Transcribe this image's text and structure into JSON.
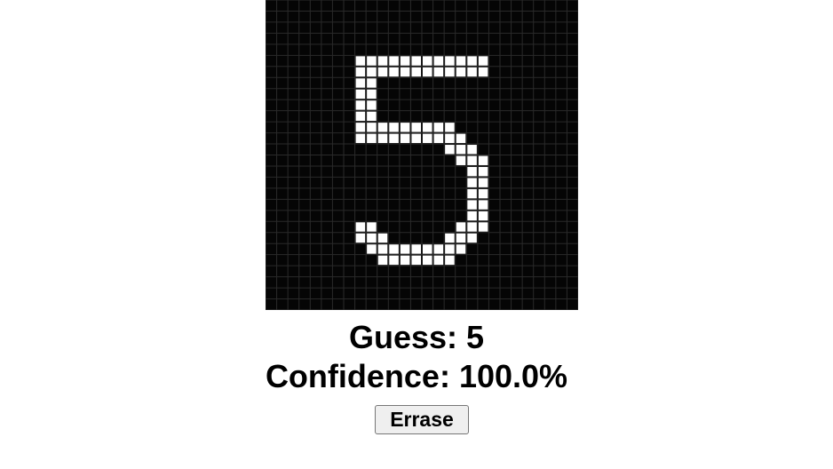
{
  "canvas": {
    "grid_cols": 28,
    "grid_rows": 28,
    "background_color": "#050505",
    "grid_line_color": "#2a2a2a",
    "pixel_color": "#ffffff",
    "active_pixels": [
      [
        5,
        8
      ],
      [
        5,
        9
      ],
      [
        5,
        10
      ],
      [
        5,
        11
      ],
      [
        5,
        12
      ],
      [
        5,
        13
      ],
      [
        5,
        14
      ],
      [
        5,
        15
      ],
      [
        5,
        16
      ],
      [
        5,
        17
      ],
      [
        5,
        18
      ],
      [
        5,
        19
      ],
      [
        6,
        8
      ],
      [
        6,
        9
      ],
      [
        6,
        10
      ],
      [
        6,
        11
      ],
      [
        6,
        12
      ],
      [
        6,
        13
      ],
      [
        6,
        14
      ],
      [
        6,
        15
      ],
      [
        6,
        16
      ],
      [
        6,
        17
      ],
      [
        6,
        18
      ],
      [
        6,
        19
      ],
      [
        7,
        8
      ],
      [
        7,
        9
      ],
      [
        8,
        8
      ],
      [
        8,
        9
      ],
      [
        9,
        8
      ],
      [
        9,
        9
      ],
      [
        10,
        8
      ],
      [
        10,
        9
      ],
      [
        11,
        8
      ],
      [
        11,
        9
      ],
      [
        11,
        10
      ],
      [
        11,
        11
      ],
      [
        11,
        12
      ],
      [
        11,
        13
      ],
      [
        11,
        14
      ],
      [
        11,
        15
      ],
      [
        11,
        16
      ],
      [
        12,
        8
      ],
      [
        12,
        9
      ],
      [
        12,
        10
      ],
      [
        12,
        11
      ],
      [
        12,
        12
      ],
      [
        12,
        13
      ],
      [
        12,
        14
      ],
      [
        12,
        15
      ],
      [
        12,
        16
      ],
      [
        12,
        17
      ],
      [
        13,
        16
      ],
      [
        13,
        17
      ],
      [
        13,
        18
      ],
      [
        14,
        17
      ],
      [
        14,
        18
      ],
      [
        14,
        19
      ],
      [
        15,
        18
      ],
      [
        15,
        19
      ],
      [
        16,
        18
      ],
      [
        16,
        19
      ],
      [
        17,
        18
      ],
      [
        17,
        19
      ],
      [
        18,
        18
      ],
      [
        18,
        19
      ],
      [
        19,
        18
      ],
      [
        19,
        19
      ],
      [
        20,
        8
      ],
      [
        20,
        9
      ],
      [
        20,
        17
      ],
      [
        20,
        18
      ],
      [
        20,
        19
      ],
      [
        21,
        8
      ],
      [
        21,
        9
      ],
      [
        21,
        10
      ],
      [
        21,
        16
      ],
      [
        21,
        17
      ],
      [
        21,
        18
      ],
      [
        22,
        9
      ],
      [
        22,
        10
      ],
      [
        22,
        11
      ],
      [
        22,
        12
      ],
      [
        22,
        13
      ],
      [
        22,
        14
      ],
      [
        22,
        15
      ],
      [
        22,
        16
      ],
      [
        22,
        17
      ],
      [
        23,
        10
      ],
      [
        23,
        11
      ],
      [
        23,
        12
      ],
      [
        23,
        13
      ],
      [
        23,
        14
      ],
      [
        23,
        15
      ],
      [
        23,
        16
      ]
    ]
  },
  "result": {
    "guess_text": "Guess: 5",
    "confidence_text": "Confidence: 100.0%"
  },
  "controls": {
    "erase_label": "Errase"
  }
}
